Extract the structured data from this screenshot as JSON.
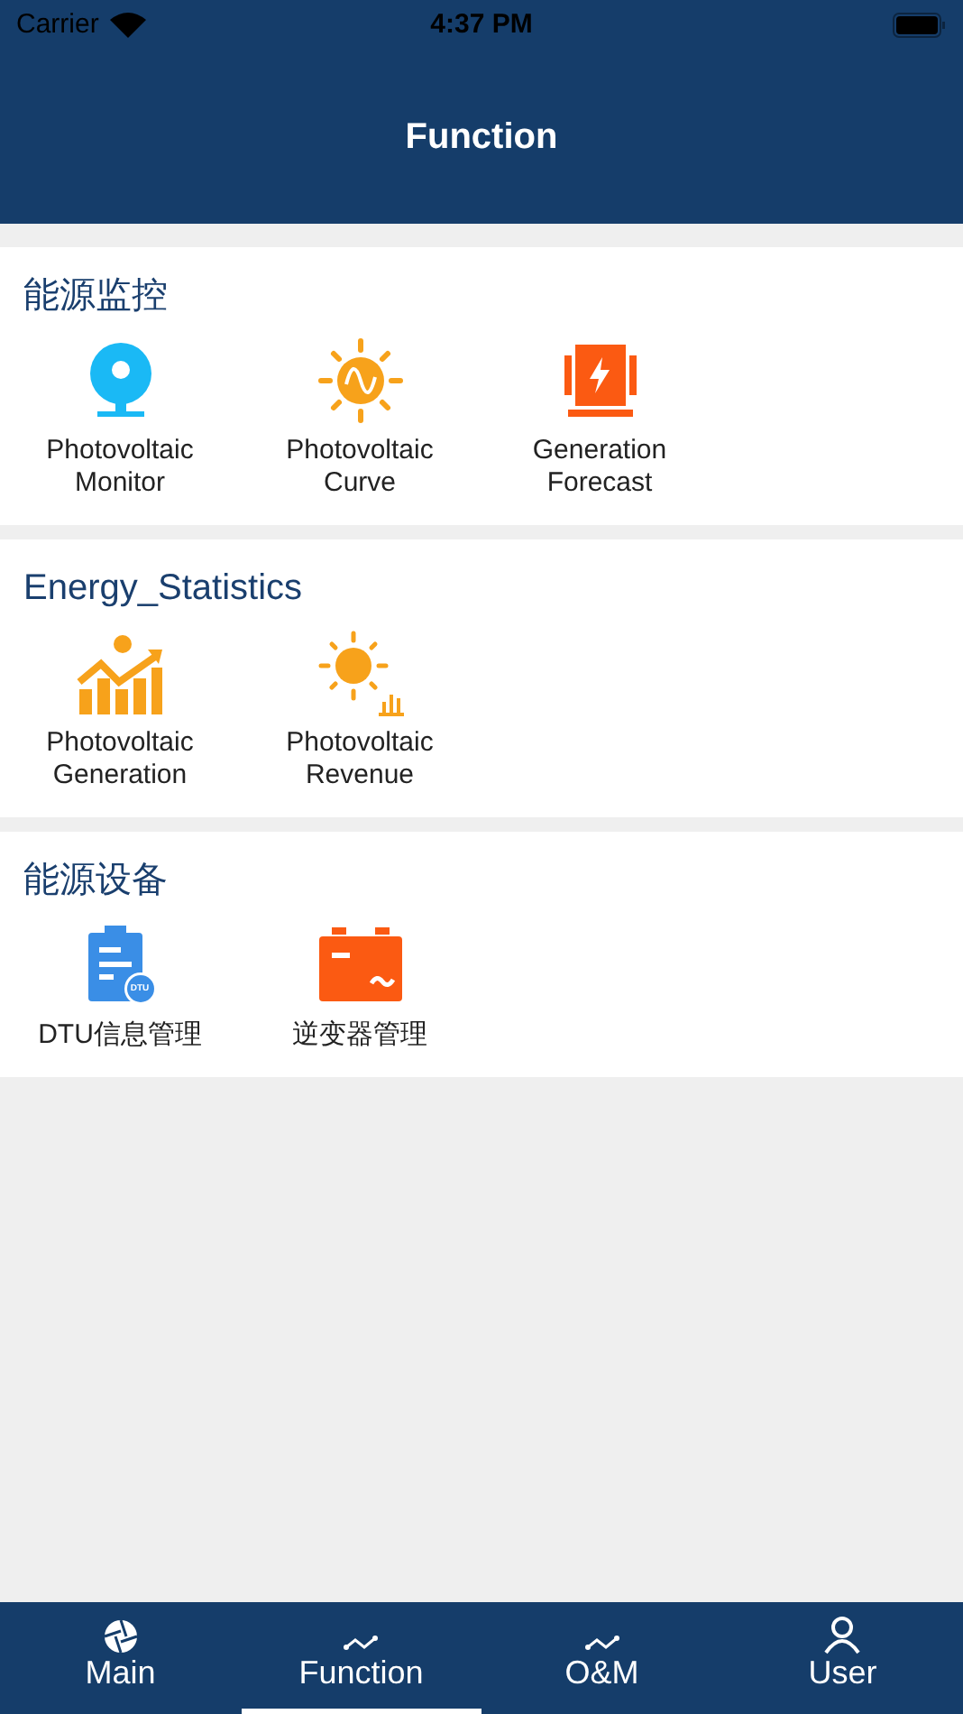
{
  "status_bar": {
    "carrier": "Carrier",
    "time": "4:37 PM"
  },
  "header": {
    "title": "Function"
  },
  "sections": [
    {
      "title": "能源监控",
      "items": [
        {
          "kind": "monitor",
          "label": "Photovoltaic\nMonitor"
        },
        {
          "kind": "curve",
          "label": "Photovoltaic\nCurve"
        },
        {
          "kind": "forecast",
          "label": "Generation\nForecast"
        }
      ]
    },
    {
      "title": "Energy_Statistics",
      "items": [
        {
          "kind": "generation",
          "label": "Photovoltaic\nGeneration"
        },
        {
          "kind": "revenue",
          "label": "Photovoltaic\nRevenue"
        }
      ]
    },
    {
      "title": "能源设备",
      "items": [
        {
          "kind": "dtu",
          "label": "DTU信息管理",
          "badge": "DTU"
        },
        {
          "kind": "battery",
          "label": "逆变器管理"
        }
      ]
    }
  ],
  "tabs": [
    {
      "kind": "aperture",
      "label": "Main",
      "selected": false
    },
    {
      "kind": "trend",
      "label": "Function",
      "selected": true
    },
    {
      "kind": "trend",
      "label": "O&M",
      "selected": false
    },
    {
      "kind": "user",
      "label": "User",
      "selected": false
    }
  ]
}
